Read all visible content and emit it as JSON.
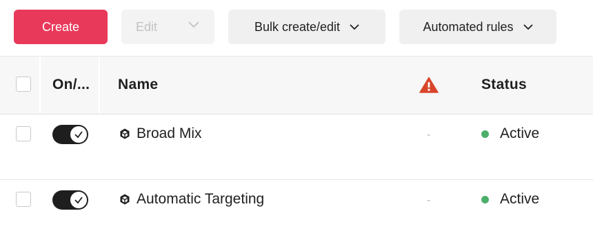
{
  "toolbar": {
    "create_label": "Create",
    "edit_label": "Edit",
    "bulk_label": "Bulk create/edit",
    "rules_label": "Automated rules"
  },
  "table": {
    "headers": {
      "toggle": "On/...",
      "name": "Name",
      "warning_icon": "warning-icon",
      "status": "Status"
    },
    "rows": [
      {
        "enabled": true,
        "icon": "cube-icon",
        "name": "Broad Mix",
        "warning": "-",
        "status": "Active"
      },
      {
        "enabled": true,
        "icon": "cube-icon",
        "name": "Automatic Targeting",
        "warning": "-",
        "status": "Active"
      }
    ]
  },
  "colors": {
    "primary": "#e8395b",
    "warning": "#d9452b",
    "active": "#4caf6a",
    "toggle_on": "#1e1e1e"
  }
}
